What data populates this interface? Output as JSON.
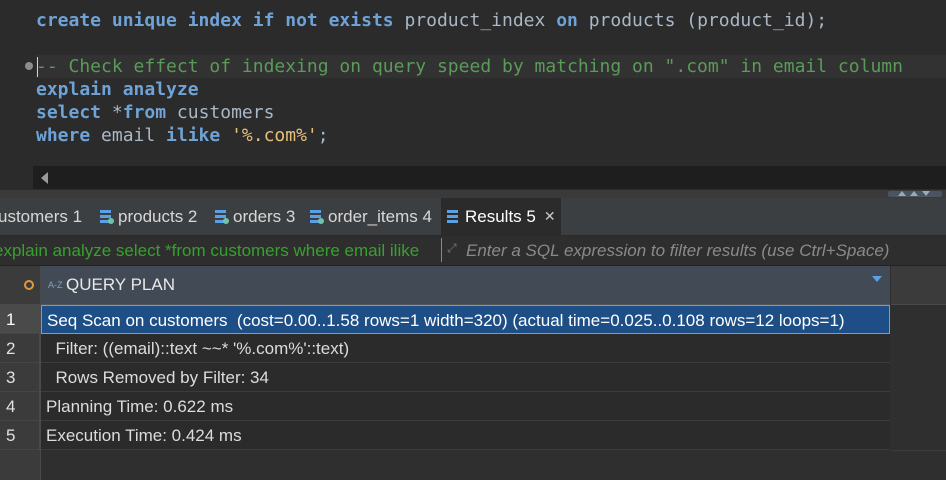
{
  "editor": {
    "line1": {
      "kw1": "create unique index if not exists",
      "plain1": " product_index ",
      "kw2": "on",
      "plain2": " products (product_id);"
    },
    "comment": "-- Check effect of indexing on query speed by matching on \".com\" in email column",
    "line3": "explain analyze",
    "line4": {
      "kw1": "select",
      "plain1": " *",
      "kw2": "from",
      "plain2": " customers"
    },
    "line5": {
      "kw1": "where",
      "plain1": " email ",
      "kw2": "ilike",
      "plain2": " ",
      "str": "'%.com%'",
      "plain3": ";"
    }
  },
  "tabs": [
    {
      "label": "ustomers 1"
    },
    {
      "label": "products 2"
    },
    {
      "label": "orders 3"
    },
    {
      "label": "order_items 4"
    },
    {
      "label": "Results 5",
      "active": true
    }
  ],
  "filter": {
    "query_text": "explain analyze select *from customers where email ilike",
    "placeholder": "Enter a SQL expression to filter results (use Ctrl+Space)"
  },
  "grid": {
    "column_type": "A-Z",
    "column": "QUERY PLAN",
    "rows": [
      {
        "num": "1",
        "text": "Seq Scan on customers  (cost=0.00..1.58 rows=1 width=320) (actual time=0.025..0.108 rows=12 loops=1)"
      },
      {
        "num": "2",
        "text": "  Filter: ((email)::text ~~* '%.com%'::text)"
      },
      {
        "num": "3",
        "text": "  Rows Removed by Filter: 34"
      },
      {
        "num": "4",
        "text": "Planning Time: 0.622 ms"
      },
      {
        "num": "5",
        "text": "Execution Time: 0.424 ms"
      }
    ]
  },
  "colors": {
    "keyword": "#6fa3d8",
    "string": "#e8c07a",
    "comment": "#5b9b59",
    "selection": "#1d4e86"
  }
}
